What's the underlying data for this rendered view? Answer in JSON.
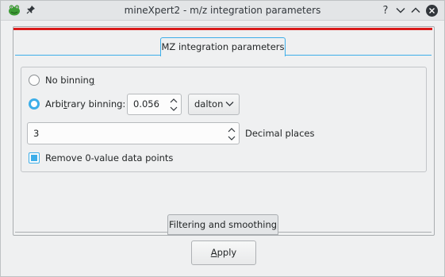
{
  "window": {
    "title": "mineXpert2 - m/z integration parameters",
    "help_label": "?"
  },
  "tabs": {
    "top": "MZ integration parameters",
    "bottom": "Filtering and smoothing"
  },
  "binning": {
    "no_binning_label_pre": "No binnin",
    "no_binning_label_ul": "g",
    "no_binning_selected": false,
    "arbitrary_label_pre": "Arbi",
    "arbitrary_label_ul": "t",
    "arbitrary_label_post": "rary binning:",
    "arbitrary_selected": true,
    "bin_size_value": "0.056",
    "unit_selected": "dalton"
  },
  "decimal": {
    "value": "3",
    "label": "Decimal places"
  },
  "remove_zero": {
    "label": "Remove 0-value data points",
    "checked": true
  },
  "footer": {
    "apply_ul": "A",
    "apply_rest": "pply"
  },
  "colors": {
    "accent": "#3daee9",
    "red_line": "#da1b1b"
  }
}
